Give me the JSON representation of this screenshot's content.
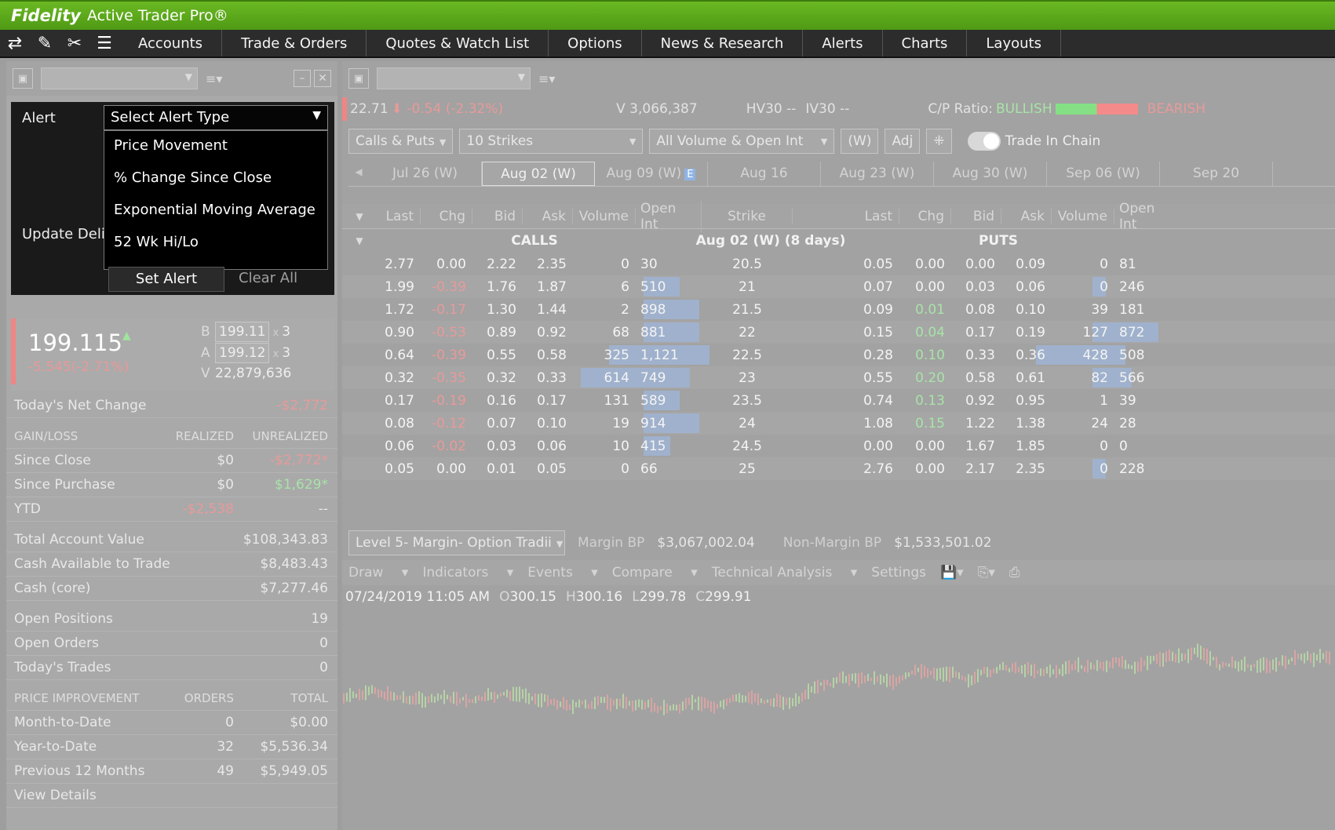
{
  "titlebar": {
    "brand": "Fidelity",
    "app": "Active Trader Pro®"
  },
  "menubar": {
    "tools": [
      "⇄",
      "✎",
      "✂",
      "☰"
    ],
    "menus": [
      "Accounts",
      "Trade & Orders",
      "Quotes & Watch List",
      "Options",
      "News & Research",
      "Alerts",
      "Charts",
      "Layouts"
    ]
  },
  "alert": {
    "label": "Alert",
    "select_value": "Select Alert Type",
    "options": [
      "Price Movement",
      "% Change Since Close",
      "Exponential Moving Average",
      "52 Wk Hi/Lo"
    ],
    "update_label": "Update Delivery",
    "set_button": "Set Alert",
    "clear_button": "Clear All"
  },
  "quote": {
    "price": "199.115",
    "change": "-5.545(-2.71%)",
    "bid_label": "B",
    "bid": "199.11",
    "bid_size": "3",
    "ask_label": "A",
    "ask": "199.12",
    "ask_size": "3",
    "vol_label": "V",
    "volume": "22,879,636",
    "x": "x"
  },
  "stats": {
    "net_change_label": "Today's Net Change",
    "net_change": "-$2,772",
    "gl_header": [
      "GAIN/LOSS",
      "REALIZED",
      "UNREALIZED"
    ],
    "since_close": [
      "Since Close",
      "$0",
      "-$2,772*"
    ],
    "since_purchase": [
      "Since Purchase",
      "$0",
      "$1,629*"
    ],
    "ytd": [
      "YTD",
      "-$2,538",
      "--"
    ],
    "total_value": [
      "Total Account Value",
      "$108,343.83"
    ],
    "cash_trade": [
      "Cash Available to Trade",
      "$8,483.43"
    ],
    "cash_core": [
      "Cash (core)",
      "$7,277.46"
    ],
    "open_positions": [
      "Open Positions",
      "19"
    ],
    "open_orders": [
      "Open Orders",
      "0"
    ],
    "todays_trades": [
      "Today's Trades",
      "0"
    ],
    "pi_header": [
      "PRICE IMPROVEMENT",
      "ORDERS",
      "TOTAL"
    ],
    "mtd": [
      "Month-to-Date",
      "0",
      "$0.00"
    ],
    "ytd2": [
      "Year-to-Date",
      "32",
      "$5,536.34"
    ],
    "prev12": [
      "Previous 12 Months",
      "49",
      "$5,949.05"
    ],
    "view_details": "View Details"
  },
  "options_quote": {
    "last": "22.71",
    "chg": "-0.54 (-2.32%)",
    "volume": "V 3,066,387",
    "hv30": "HV30 --",
    "iv30": "IV30 --",
    "cp_label": "C/P Ratio:",
    "bullish": "BULLISH",
    "bearish": "BEARISH"
  },
  "controls": {
    "type": "Calls & Puts",
    "strikes": "10 Strikes",
    "volume": "All Volume & Open Int",
    "weekly": "(W)",
    "adj": "Adj",
    "trade_in_chain": "Trade In Chain"
  },
  "dates": [
    "Jul 26 (W)",
    "Aug 02 (W)",
    "Aug 09 (W)",
    "Aug 16",
    "Aug 23 (W)",
    "Aug 30 (W)",
    "Sep 06 (W)",
    "Sep 20"
  ],
  "earnings_badge": "E",
  "chain": {
    "headers": [
      "Last",
      "Chg",
      "Bid",
      "Ask",
      "Volume",
      "Open Int",
      "Strike",
      "Last",
      "Chg",
      "Bid",
      "Ask",
      "Volume",
      "Open Int"
    ],
    "calls_label": "CALLS",
    "expiry_label": "Aug 02 (W) (8 days)",
    "puts_label": "PUTS",
    "rows": [
      {
        "c_last": "2.77",
        "c_chg": "0.00",
        "c_bid": "2.22",
        "c_ask": "2.35",
        "c_vol": "0",
        "c_oi": "30",
        "strike": "20.5",
        "p_last": "0.05",
        "p_chg": "0.00",
        "p_bid": "0.00",
        "p_ask": "0.09",
        "p_vol": "0",
        "p_oi": "81",
        "c_chg_dir": "flat",
        "p_chg_dir": "flat",
        "c_oi_w": 0.0,
        "c_vol_w": 0.0,
        "p_oi_w": 0.0,
        "p_vol_w": 0.0
      },
      {
        "c_last": "1.99",
        "c_chg": "-0.39",
        "c_bid": "1.76",
        "c_ask": "1.87",
        "c_vol": "6",
        "c_oi": "510",
        "strike": "21",
        "p_last": "0.07",
        "p_chg": "0.00",
        "p_bid": "0.03",
        "p_ask": "0.06",
        "p_vol": "0",
        "p_oi": "246",
        "c_chg_dir": "neg",
        "p_chg_dir": "flat",
        "c_oi_w": 0.55,
        "c_vol_w": 0.0,
        "p_oi_w": 0.2,
        "p_vol_w": 0.0
      },
      {
        "c_last": "1.72",
        "c_chg": "-0.17",
        "c_bid": "1.30",
        "c_ask": "1.44",
        "c_vol": "2",
        "c_oi": "898",
        "strike": "21.5",
        "p_last": "0.09",
        "p_chg": "0.01",
        "p_bid": "0.08",
        "p_ask": "0.10",
        "p_vol": "39",
        "p_oi": "181",
        "c_chg_dir": "neg",
        "p_chg_dir": "pos",
        "c_oi_w": 0.85,
        "c_vol_w": 0.0,
        "p_oi_w": 0.0,
        "p_vol_w": 0.0
      },
      {
        "c_last": "0.90",
        "c_chg": "-0.53",
        "c_bid": "0.89",
        "c_ask": "0.92",
        "c_vol": "68",
        "c_oi": "881",
        "strike": "22",
        "p_last": "0.15",
        "p_chg": "0.04",
        "p_bid": "0.17",
        "p_ask": "0.19",
        "p_vol": "127",
        "p_oi": "872",
        "c_chg_dir": "neg",
        "p_chg_dir": "pos",
        "c_oi_w": 0.85,
        "c_vol_w": 0.0,
        "p_oi_w": 1.0,
        "p_vol_w": 0.0
      },
      {
        "c_last": "0.64",
        "c_chg": "-0.39",
        "c_bid": "0.55",
        "c_ask": "0.58",
        "c_vol": "325",
        "c_oi": "1,121",
        "strike": "22.5",
        "p_last": "0.28",
        "p_chg": "0.10",
        "p_bid": "0.33",
        "p_ask": "0.36",
        "p_vol": "428",
        "p_oi": "508",
        "c_chg_dir": "neg",
        "p_chg_dir": "pos",
        "c_oi_w": 1.0,
        "c_vol_w": 0.55,
        "p_oi_w": 0.5,
        "p_vol_w": 0.9
      },
      {
        "c_last": "0.32",
        "c_chg": "-0.35",
        "c_bid": "0.32",
        "c_ask": "0.33",
        "c_vol": "614",
        "c_oi": "749",
        "strike": "23",
        "p_last": "0.55",
        "p_chg": "0.20",
        "p_bid": "0.58",
        "p_ask": "0.61",
        "p_vol": "82",
        "p_oi": "566",
        "c_chg_dir": "neg",
        "p_chg_dir": "pos",
        "c_oi_w": 0.7,
        "c_vol_w": 1.0,
        "p_oi_w": 0.6,
        "p_vol_w": 0.0
      },
      {
        "c_last": "0.17",
        "c_chg": "-0.19",
        "c_bid": "0.16",
        "c_ask": "0.17",
        "c_vol": "131",
        "c_oi": "589",
        "strike": "23.5",
        "p_last": "0.74",
        "p_chg": "0.13",
        "p_bid": "0.92",
        "p_ask": "0.95",
        "p_vol": "1",
        "p_oi": "39",
        "c_chg_dir": "neg",
        "p_chg_dir": "pos",
        "c_oi_w": 0.55,
        "c_vol_w": 0.0,
        "p_oi_w": 0.0,
        "p_vol_w": 0.0
      },
      {
        "c_last": "0.08",
        "c_chg": "-0.12",
        "c_bid": "0.07",
        "c_ask": "0.10",
        "c_vol": "19",
        "c_oi": "914",
        "strike": "24",
        "p_last": "1.08",
        "p_chg": "0.15",
        "p_bid": "1.22",
        "p_ask": "1.38",
        "p_vol": "24",
        "p_oi": "28",
        "c_chg_dir": "neg",
        "p_chg_dir": "pos",
        "c_oi_w": 0.85,
        "c_vol_w": 0.0,
        "p_oi_w": 0.0,
        "p_vol_w": 0.0
      },
      {
        "c_last": "0.06",
        "c_chg": "-0.02",
        "c_bid": "0.03",
        "c_ask": "0.06",
        "c_vol": "10",
        "c_oi": "415",
        "strike": "24.5",
        "p_last": "0.00",
        "p_chg": "0.00",
        "p_bid": "1.67",
        "p_ask": "1.85",
        "p_vol": "0",
        "p_oi": "0",
        "c_chg_dir": "neg",
        "p_chg_dir": "flat",
        "c_oi_w": 0.4,
        "c_vol_w": 0.0,
        "p_oi_w": 0.0,
        "p_vol_w": 0.0
      },
      {
        "c_last": "0.05",
        "c_chg": "0.00",
        "c_bid": "0.01",
        "c_ask": "0.05",
        "c_vol": "0",
        "c_oi": "66",
        "strike": "25",
        "p_last": "2.76",
        "p_chg": "0.00",
        "p_bid": "2.17",
        "p_ask": "2.35",
        "p_vol": "0",
        "p_oi": "228",
        "c_chg_dir": "flat",
        "p_chg_dir": "flat",
        "c_oi_w": 0.0,
        "c_vol_w": 0.0,
        "p_oi_w": 0.2,
        "p_vol_w": 0.0
      }
    ]
  },
  "margin": {
    "account": "Level 5- Margin- Option Tradii",
    "margin_bp_label": "Margin BP",
    "margin_bp": "$3,067,002.04",
    "non_margin_label": "Non-Margin BP",
    "non_margin": "$1,533,501.02"
  },
  "chart_toolbar": [
    "Draw",
    "Indicators",
    "Events",
    "Compare",
    "Technical Analysis",
    "Settings"
  ],
  "ohlc": {
    "datetime": "07/24/2019 11:05 AM",
    "o_label": "O",
    "o": "300.15",
    "h_label": "H",
    "h": "300.16",
    "l_label": "L",
    "l": "299.78",
    "c_label": "C",
    "c": "299.91"
  },
  "colors": {
    "up": "#a8e3a8",
    "down": "#e89a9a",
    "brand_green": "#5aa819"
  }
}
